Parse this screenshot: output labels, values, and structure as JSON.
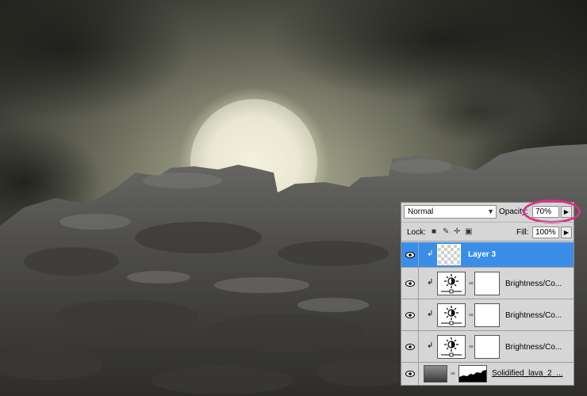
{
  "layers_panel": {
    "blend_mode": "Normal",
    "opacity_label": "Opacity:",
    "opacity_value": "70%",
    "lock_label": "Lock:",
    "fill_label": "Fill:",
    "fill_value": "100%",
    "layers": [
      {
        "name": "Layer 3",
        "selected": true,
        "visible": true,
        "type": "pixel",
        "clipped": true
      },
      {
        "name": "Brightness/Co...",
        "selected": false,
        "visible": true,
        "type": "adjustment",
        "clipped": true
      },
      {
        "name": "Brightness/Co...",
        "selected": false,
        "visible": true,
        "type": "adjustment",
        "clipped": true
      },
      {
        "name": "Brightness/Co...",
        "selected": false,
        "visible": true,
        "type": "adjustment",
        "clipped": true
      },
      {
        "name": "Solidified_lava_2_...",
        "selected": false,
        "visible": true,
        "type": "masked-image",
        "clipped": false
      }
    ]
  },
  "colors": {
    "selection": "#3a8ee8",
    "highlight_ring": "#d8338a",
    "panel_bg": "#d6d6d6"
  }
}
